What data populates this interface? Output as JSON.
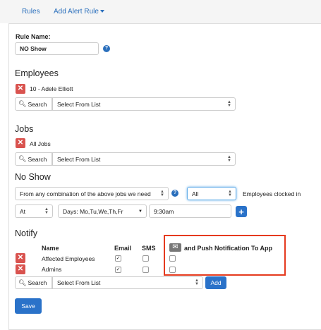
{
  "nav": {
    "rules": "Rules",
    "add_alert_rule": "Add Alert Rule"
  },
  "rule_name": {
    "label": "Rule Name:",
    "value": "NO Show"
  },
  "employees": {
    "heading": "Employees",
    "selected": "10 - Adele Elliott",
    "search_label": "Search",
    "select_placeholder": "Select From List"
  },
  "jobs": {
    "heading": "Jobs",
    "selected": "All Jobs",
    "search_label": "Search",
    "select_placeholder": "Select From List"
  },
  "no_show": {
    "heading": "No Show",
    "combination_select": "From any combination of the above jobs we need",
    "count_select": "All",
    "employees_text": "Employees clocked in",
    "at_select": "At",
    "days_select": "Days: Mo,Tu,We,Th,Fr",
    "time_value": "9:30am",
    "add_glyph": "+"
  },
  "notify": {
    "heading": "Notify",
    "col_name": "Name",
    "col_email": "Email",
    "col_sms": "SMS",
    "col_push": "and Push Notification To App",
    "rows": [
      {
        "name": "Affected Employees",
        "email": true,
        "sms": false,
        "push": false
      },
      {
        "name": "Admins",
        "email": true,
        "sms": false,
        "push": false
      }
    ],
    "search_label": "Search",
    "select_placeholder": "Select From List",
    "add_button": "Add"
  },
  "save_button": "Save",
  "colors": {
    "accent": "#2a72c9",
    "remove": "#d9534f",
    "highlight": "#e53a1e"
  }
}
